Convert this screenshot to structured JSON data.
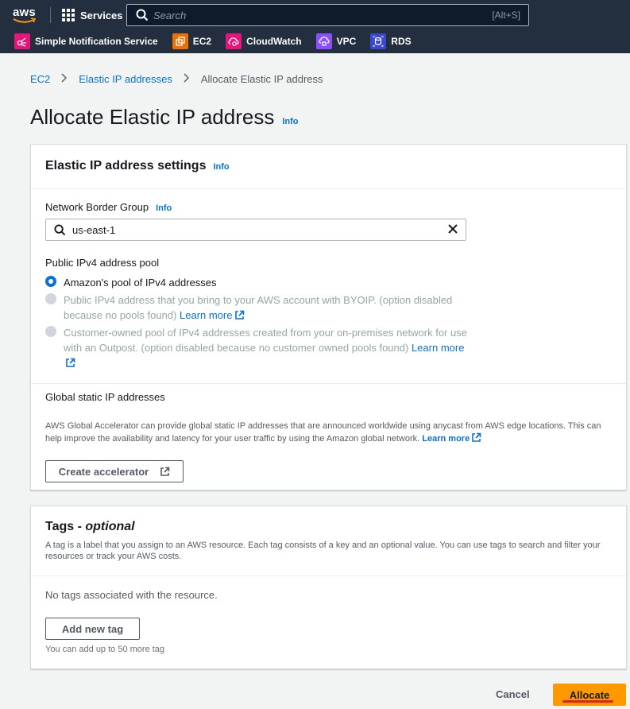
{
  "nav": {
    "logo": "aws",
    "services_label": "Services",
    "search_placeholder": "Search",
    "search_shortcut": "[Alt+S]",
    "favorites": [
      {
        "label": "Simple Notification Service",
        "icon": "sns-icon",
        "color": "#e7157b"
      },
      {
        "label": "EC2",
        "icon": "ec2-icon",
        "color": "#ed7100"
      },
      {
        "label": "CloudWatch",
        "icon": "cloudwatch-icon",
        "color": "#e7157b"
      },
      {
        "label": "VPC",
        "icon": "vpc-icon",
        "color": "#8c4fff"
      },
      {
        "label": "RDS",
        "icon": "rds-icon",
        "color": "#3b48cc"
      }
    ]
  },
  "breadcrumb": {
    "items": [
      "EC2",
      "Elastic IP addresses"
    ],
    "current": "Allocate Elastic IP address"
  },
  "page": {
    "title": "Allocate Elastic IP address",
    "info": "Info"
  },
  "settings": {
    "title": "Elastic IP address settings",
    "info": "Info",
    "nbg_label": "Network Border Group",
    "nbg_info": "Info",
    "nbg_value": "us-east-1",
    "pool_label": "Public IPv4 address pool",
    "options": [
      {
        "text": "Amazon's pool of IPv4 addresses",
        "selected": true,
        "disabled": false
      },
      {
        "text": "Public IPv4 address that you bring to your AWS account with BYOIP. (option disabled because no pools found)",
        "link": "Learn more",
        "selected": false,
        "disabled": true
      },
      {
        "text": "Customer-owned pool of IPv4 addresses created from your on-premises network for use with an Outpost. (option disabled because no customer owned pools found)",
        "link": "Learn more",
        "selected": false,
        "disabled": true
      }
    ],
    "global_label": "Global static IP addresses",
    "global_desc": "AWS Global Accelerator can provide global static IP addresses that are announced worldwide using anycast from AWS edge locations. This can help improve the availability and latency for your user traffic by using the Amazon global network.",
    "global_link": "Learn more",
    "create_accel": "Create accelerator"
  },
  "tags": {
    "title": "Tags - ",
    "title_optional": "optional",
    "desc": "A tag is a label that you assign to an AWS resource. Each tag consists of a key and an optional value. You can use tags to search and filter your resources or track your AWS costs.",
    "empty": "No tags associated with the resource.",
    "add_button": "Add new tag",
    "hint": "You can add up to 50 more tag"
  },
  "footer": {
    "cancel": "Cancel",
    "allocate": "Allocate"
  },
  "colors": {
    "primary": "#ff9900",
    "link": "#0972d3",
    "nav_bg": "#232f3e"
  }
}
